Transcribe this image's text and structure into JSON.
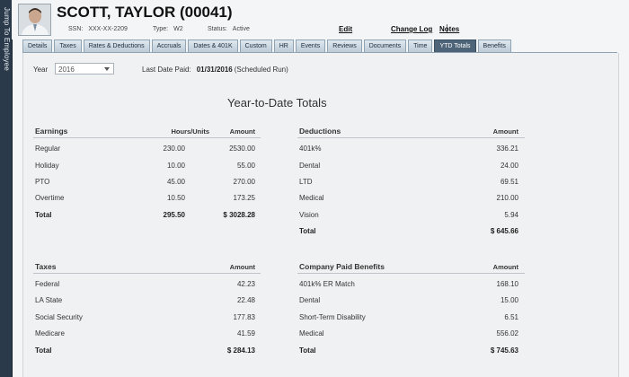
{
  "jump_rail": {
    "label": "Jump To Employee"
  },
  "employee": {
    "name": "SCOTT, TAYLOR (00041)",
    "ssn_label": "SSN:",
    "ssn": "XXX-XX-2209",
    "type_label": "Type:",
    "type": "W2",
    "status_label": "Status:",
    "status": "Active"
  },
  "header_links": {
    "edit": "Edit",
    "change_log": "Change Log",
    "notes": "Notes"
  },
  "tabs": [
    "Details",
    "Taxes",
    "Rates & Deductions",
    "Accruals",
    "Dates & 401K",
    "Custom",
    "HR",
    "Events",
    "Reviews",
    "Documents",
    "Time",
    "YTD Totals",
    "Benefits"
  ],
  "active_tab": "YTD Totals",
  "filters": {
    "year_label": "Year",
    "year": "2016",
    "last_date_paid_label": "Last Date Paid:",
    "last_date_paid": "01/31/2016",
    "last_date_paid_note": "(Scheduled Run)"
  },
  "title": "Year-to-Date Totals",
  "earnings": {
    "heading": "Earnings",
    "col_hours": "Hours/Units",
    "col_amount": "Amount",
    "rows": [
      {
        "label": "Regular",
        "hours": "230.00",
        "amount": "2530.00"
      },
      {
        "label": "Holiday",
        "hours": "10.00",
        "amount": "55.00"
      },
      {
        "label": "PTO",
        "hours": "45.00",
        "amount": "270.00"
      },
      {
        "label": "Overtime",
        "hours": "10.50",
        "amount": "173.25"
      }
    ],
    "total": {
      "label": "Total",
      "hours": "295.50",
      "amount": "$ 3028.28"
    }
  },
  "deductions": {
    "heading": "Deductions",
    "col_amount": "Amount",
    "rows": [
      {
        "label": "401k%",
        "amount": "336.21"
      },
      {
        "label": "Dental",
        "amount": "24.00"
      },
      {
        "label": "LTD",
        "amount": "69.51"
      },
      {
        "label": "Medical",
        "amount": "210.00"
      },
      {
        "label": "Vision",
        "amount": "5.94"
      }
    ],
    "total": {
      "label": "Total",
      "amount": "$ 645.66"
    }
  },
  "taxes": {
    "heading": "Taxes",
    "col_amount": "Amount",
    "rows": [
      {
        "label": "Federal",
        "amount": "42.23"
      },
      {
        "label": "LA State",
        "amount": "22.48"
      },
      {
        "label": "Social Security",
        "amount": "177.83"
      },
      {
        "label": "Medicare",
        "amount": "41.59"
      }
    ],
    "total": {
      "label": "Total",
      "amount": "$ 284.13"
    }
  },
  "company_benefits": {
    "heading": "Company Paid Benefits",
    "col_amount": "Amount",
    "rows": [
      {
        "label": "401k% ER Match",
        "amount": "168.10"
      },
      {
        "label": "Dental",
        "amount": "15.00"
      },
      {
        "label": "Short-Term Disability",
        "amount": "6.51"
      },
      {
        "label": "Medical",
        "amount": "556.02"
      }
    ],
    "total": {
      "label": "Total",
      "amount": "$ 745.63"
    }
  }
}
